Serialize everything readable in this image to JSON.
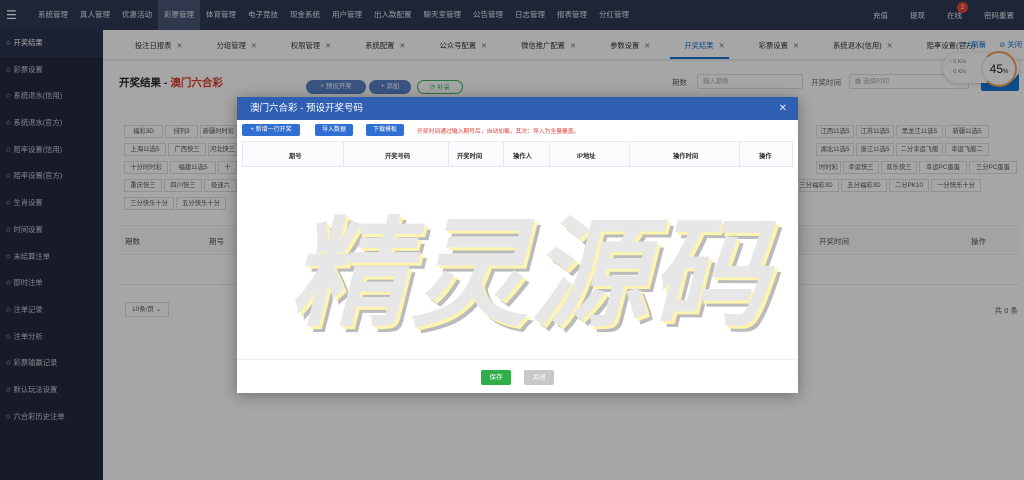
{
  "topbar": {
    "nav": [
      "系统管理",
      "真人管理",
      "优惠活动",
      "彩票管理",
      "体育管理",
      "电子竞技",
      "现金系统",
      "用户管理",
      "出入款配置",
      "聊天室管理",
      "公告管理",
      "日志管理",
      "报表管理",
      "分红管理"
    ],
    "active_index": 3,
    "right": {
      "recharge": "充值",
      "withdraw": "提现",
      "online": "在线",
      "online_count": "2",
      "reset_password": "密码重置"
    }
  },
  "sidebar": {
    "items": [
      {
        "label": "开奖结果",
        "active": true
      },
      {
        "label": "彩票设置"
      },
      {
        "label": "系统退水(信用)"
      },
      {
        "label": "系统退水(官方)"
      },
      {
        "label": "赔率设置(信用)"
      },
      {
        "label": "赔率设置(官方)"
      },
      {
        "label": "生肖设置"
      },
      {
        "label": "时间设置"
      },
      {
        "label": "未结算注单"
      },
      {
        "label": "即时注单"
      },
      {
        "label": "注单记录"
      },
      {
        "label": "注单分析"
      },
      {
        "label": "彩票输赢记录"
      },
      {
        "label": "默认玩法设置"
      },
      {
        "label": "六合彩历史注单"
      }
    ]
  },
  "tabs": {
    "items": [
      "投注日报表",
      "分组管理",
      "权限管理",
      "系统配置",
      "公众号配置",
      "微信推广配置",
      "参数设置",
      "开奖结果",
      "彩票设置",
      "系统退水(信用)",
      "赔率设置(官方)"
    ],
    "active_index": 7,
    "refresh": "刷新",
    "close_all": "关闭"
  },
  "page": {
    "title": "开奖结果",
    "subtitle": "澳门六合彩",
    "btn_preset": "预设开奖",
    "btn_add": "添加",
    "btn_export": "补采",
    "filter_period_label": "期数",
    "filter_period_placeholder": "输入期数",
    "filter_time_label": "开奖时间",
    "filter_time_placeholder": "选择时间"
  },
  "chips": {
    "row1": [
      "福彩3D",
      "排列3",
      "新疆时时彩",
      "江西11选5",
      "江苏11选5",
      "黑龙江11选5",
      "新疆11选5"
    ],
    "row2": [
      "上海11选5",
      "广西快三",
      "河北快三",
      "湖北11选5",
      "浙江11选5",
      "二分幸运飞艇",
      "幸运飞艇二"
    ],
    "row3": [
      "十分时时彩",
      "福建11选5",
      "十",
      "时时彩",
      "幸运快三",
      "欢乐快三",
      "幸运PC蛋蛋",
      "三分PC蛋蛋"
    ],
    "row4": [
      "重庆快三",
      "四川快三",
      "极速六",
      "三分福彩3D",
      "五分福彩3D",
      "二分PK10",
      "一分快乐十分"
    ],
    "row5": [
      "三分快乐十分",
      "五分快乐十分"
    ]
  },
  "table": {
    "headers": [
      "期数",
      "期号",
      "开奖时间",
      "操作"
    ],
    "pager_size": "10条/页",
    "total": "共 0 条"
  },
  "speed": {
    "up": "0",
    "down": "0",
    "unit": "K/s",
    "percent": "45",
    "percent_unit": "%"
  },
  "modal": {
    "title": "澳门六合彩 - 预设开奖号码",
    "btn_new_row": "+ 新增一行开奖",
    "btn_import": "导入数据",
    "btn_template": "下载模板",
    "tip": "开奖时间通过输入期号后，自动加载，其次：导入为全量覆盖。",
    "columns": [
      "期号",
      "开奖号码",
      "开奖时间",
      "操作人",
      "IP地址",
      "操作时间",
      "操作"
    ],
    "btn_save": "保存",
    "btn_close": "关闭"
  },
  "watermark": "精灵源码",
  "colors": {
    "topbar": "#2e3a55",
    "sidebar": "#222a3d",
    "accent": "#1677d4",
    "modal_header": "#2f5fb3",
    "save": "#2fae4a"
  }
}
